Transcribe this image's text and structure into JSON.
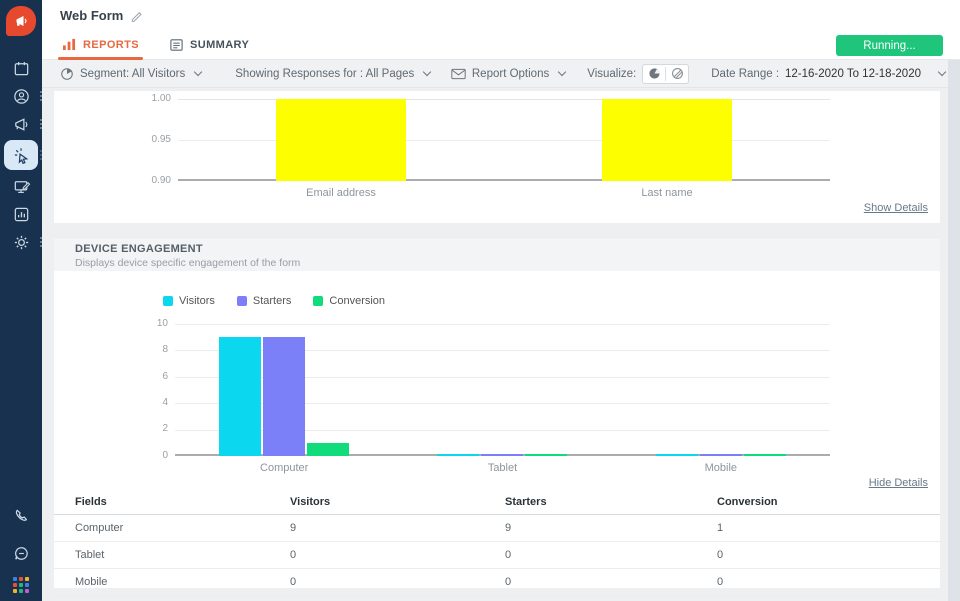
{
  "header": {
    "title": "Web Form"
  },
  "sidebar": {
    "icons": [
      "calendar",
      "contacts",
      "campaigns-megaphone",
      "web-form-click",
      "content-editor",
      "reports-chart",
      "settings-gear"
    ],
    "bottom_icons": [
      "phone",
      "chat",
      "apps-grid"
    ],
    "active_item": "web-form-click",
    "bg_color": "#17314e",
    "logo_color": "#e6492d"
  },
  "tabs": [
    {
      "label": "REPORTS",
      "active": true
    },
    {
      "label": "SUMMARY",
      "active": false
    }
  ],
  "status_button": {
    "label": "Running...",
    "color": "#1fc57b"
  },
  "toolbar": {
    "segment_label": "Segment: All Visitors",
    "showing_label": "Showing Responses for : All Pages",
    "report_options_label": "Report Options",
    "visualize_label": "Visualize:",
    "date_range_label": "Date Range :",
    "date_range_value": "12-16-2020 To 12-18-2020"
  },
  "field_section": {
    "show_details_link": "Show Details"
  },
  "device_section": {
    "title": "DEVICE ENGAGEMENT",
    "subtitle": "Displays device specific engagement of the form",
    "hide_details_link": "Hide Details"
  },
  "chart_data": [
    {
      "type": "bar",
      "categories": [
        "Email address",
        "Last name"
      ],
      "values": [
        1.0,
        1.0
      ],
      "bar_color": "#fdff00",
      "ylim": [
        0.9,
        1.0
      ],
      "ytick_labels": [
        "1.00",
        "0.95",
        "0.90"
      ],
      "grid": true,
      "legend": false
    },
    {
      "type": "bar",
      "categories": [
        "Computer",
        "Tablet",
        "Mobile"
      ],
      "series": [
        {
          "name": "Visitors",
          "color": "#0bd7ef",
          "values": [
            9,
            0,
            0
          ]
        },
        {
          "name": "Starters",
          "color": "#7b80f8",
          "values": [
            9,
            0,
            0
          ]
        },
        {
          "name": "Conversion",
          "color": "#10dc7c",
          "values": [
            1,
            0,
            0
          ]
        }
      ],
      "ylim": [
        0,
        10
      ],
      "ytick_labels": [
        "10",
        "8",
        "6",
        "4",
        "2",
        "0"
      ],
      "grid": true,
      "legend_position": "top"
    }
  ],
  "table": {
    "headers": [
      "Fields",
      "Visitors",
      "Starters",
      "Conversion"
    ],
    "rows": [
      [
        "Computer",
        "9",
        "9",
        "1"
      ],
      [
        "Tablet",
        "0",
        "0",
        "0"
      ],
      [
        "Mobile",
        "0",
        "0",
        "0"
      ]
    ]
  }
}
